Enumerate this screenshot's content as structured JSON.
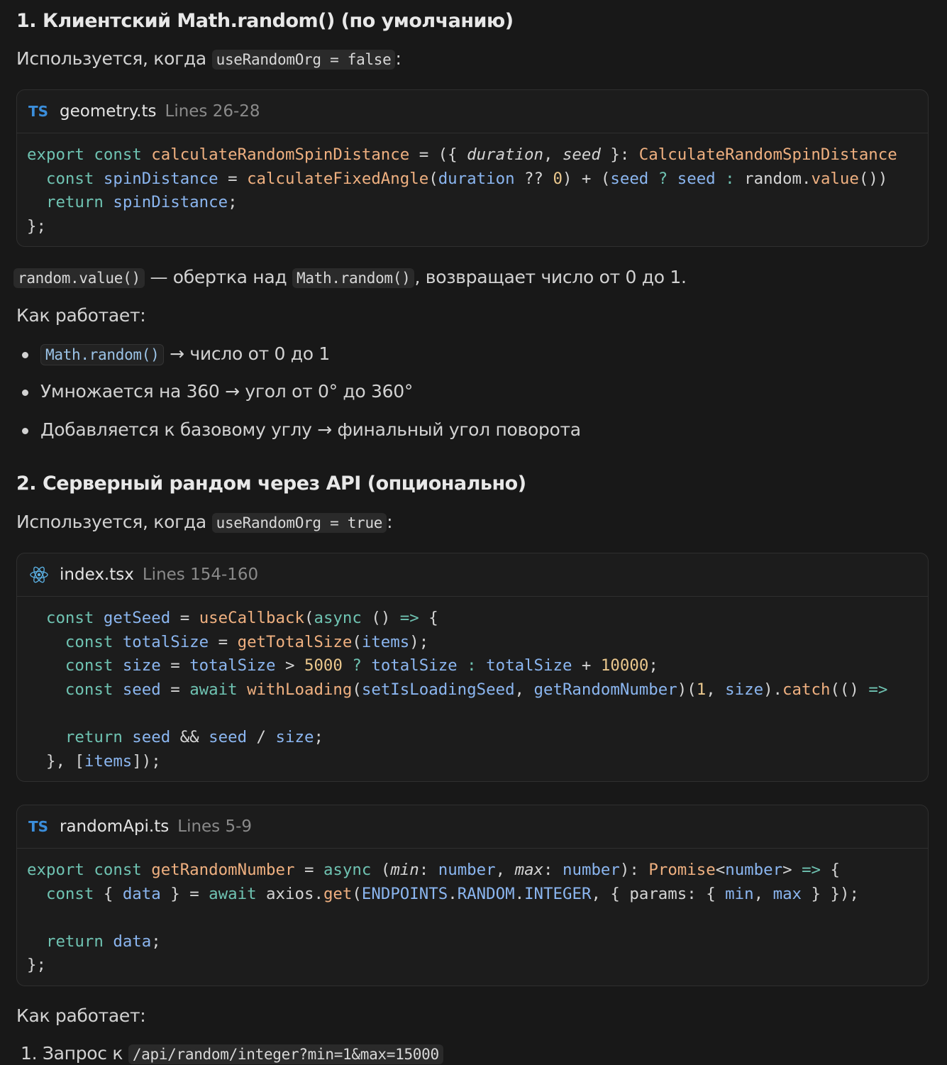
{
  "section1": {
    "heading": "1. Клиентский Math.random() (по умолчанию)",
    "used_when_prefix": "Используется, когда",
    "used_when_code": "useRandomOrg = false",
    "used_when_suffix": ":",
    "file": {
      "icon": "typescript-icon",
      "icon_text": "TS",
      "name": "geometry.ts",
      "lines": "Lines 26-28"
    },
    "code_lines": [
      "export const calculateRandomSpinDistance = ({ duration, seed }: CalculateRandomSpinDistance",
      "  const spinDistance = calculateFixedAngle(duration ?? 0) + (seed ? seed : random.value())",
      "  return spinDistance;",
      "};"
    ],
    "note_code1": "random.value()",
    "note_text1": " — обертка над ",
    "note_code2": "Math.random()",
    "note_text2": ", возвращает число от 0 до 1.",
    "how_label": "Как работает:",
    "bullets": [
      {
        "code": "Math.random()",
        "text": " → число от 0 до 1"
      },
      {
        "text": "Умножается на 360 → угол от 0° до 360°"
      },
      {
        "text": "Добавляется к базовому углу → финальный угол поворота"
      }
    ]
  },
  "section2": {
    "heading": "2. Серверный рандом через API (опционально)",
    "used_when_prefix": "Используется, когда",
    "used_when_code": "useRandomOrg = true",
    "used_when_suffix": ":",
    "file1": {
      "icon": "react-icon",
      "name": "index.tsx",
      "lines": "Lines 154-160"
    },
    "code1_lines": [
      "  const getSeed = useCallback(async () => {",
      "    const totalSize = getTotalSize(items);",
      "    const size = totalSize > 5000 ? totalSize : totalSize + 10000;",
      "    const seed = await withLoading(setIsLoadingSeed, getRandomNumber)(1, size).catch(() =>",
      "",
      "    return seed && seed / size;",
      "  }, [items]);"
    ],
    "file2": {
      "icon": "typescript-icon",
      "icon_text": "TS",
      "name": "randomApi.ts",
      "lines": "Lines 5-9"
    },
    "code2_lines": [
      "export const getRandomNumber = async (min: number, max: number): Promise<number> => {",
      "  const { data } = await axios.get(ENDPOINTS.RANDOM.INTEGER, { params: { min, max } });",
      "",
      "  return data;",
      "};"
    ],
    "how_label": "Как работает:",
    "step1_prefix": "1. Запрос к",
    "step1_code": "/api/random/integer?min=1&max=15000"
  },
  "colors": {
    "background": "#181818",
    "keyword": "#6fc3b2",
    "variable": "#8bb6f0",
    "function": "#efb080",
    "number": "#ebc88d",
    "ts_badge": "#3b8edb"
  }
}
